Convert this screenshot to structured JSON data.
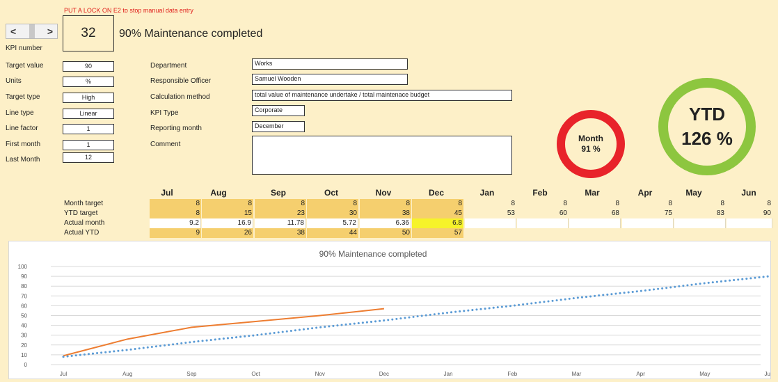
{
  "warning": "PUT A LOCK ON E2 to stop manual data entry",
  "spinner": {
    "left": "<",
    "right": ">"
  },
  "kpi": {
    "number": "32",
    "title": "90% Maintenance completed",
    "number_label": "KPI number"
  },
  "settings": [
    {
      "label": "Target value",
      "value": "90"
    },
    {
      "label": "Units",
      "value": "%"
    },
    {
      "label": "Target type",
      "value": "High"
    },
    {
      "label": "Line type",
      "value": "Linear"
    },
    {
      "label": "Line factor",
      "value": "1"
    },
    {
      "label": "First month",
      "value": "1"
    },
    {
      "label": "Last Month",
      "value": "12"
    }
  ],
  "details": [
    {
      "label": "Department",
      "value": "Works"
    },
    {
      "label": "Responsible Officer",
      "value": "Samuel Wooden"
    },
    {
      "label": "Calculation method",
      "value": "total value of maintenance undertake / total maintenace budget"
    },
    {
      "label": "KPI Type",
      "value": "Corporate"
    },
    {
      "label": "Reporting month",
      "value": "December"
    },
    {
      "label": "Comment",
      "value": ""
    }
  ],
  "month_gauge": {
    "label": "Month",
    "value": "91 %",
    "color": "#e8232a"
  },
  "ytd_gauge": {
    "label": "YTD",
    "value": "126 %",
    "color": "#8dc63f"
  },
  "table": {
    "months": [
      "Jul",
      "Aug",
      "Sep",
      "Oct",
      "Nov",
      "Dec",
      "Jan",
      "Feb",
      "Mar",
      "Apr",
      "May",
      "Jun"
    ],
    "rows": [
      {
        "label": "Month target",
        "values": [
          "8",
          "8",
          "8",
          "8",
          "8",
          "8",
          "8",
          "8",
          "8",
          "8",
          "8",
          "8"
        ]
      },
      {
        "label": "YTD target",
        "values": [
          "8",
          "15",
          "23",
          "30",
          "38",
          "45",
          "53",
          "60",
          "68",
          "75",
          "83",
          "90"
        ]
      },
      {
        "label": "Actual month",
        "values": [
          "9.2",
          "16.9",
          "11.78",
          "5.72",
          "6.36",
          "6.8",
          "",
          "",
          "",
          "",
          "",
          ""
        ]
      },
      {
        "label": "Actual YTD",
        "values": [
          "9",
          "26",
          "38",
          "44",
          "50",
          "57",
          "",
          "",
          "",
          "",
          "",
          ""
        ]
      }
    ]
  },
  "chart_data": {
    "type": "line",
    "title": "90% Maintenance completed",
    "categories": [
      "Jul",
      "Aug",
      "Sep",
      "Oct",
      "Nov",
      "Dec",
      "Jan",
      "Feb",
      "Mar",
      "Apr",
      "May",
      "Jun"
    ],
    "ylim": [
      0,
      100
    ],
    "yticks": [
      0,
      10,
      20,
      30,
      40,
      50,
      60,
      70,
      80,
      90,
      100
    ],
    "grid": true,
    "series": [
      {
        "values": [
          9,
          26,
          38,
          44,
          50,
          57,
          null,
          null,
          null,
          null,
          null,
          null
        ],
        "color": "#ed7d31",
        "style": "solid"
      },
      {
        "values": [
          8,
          15,
          23,
          30,
          38,
          45,
          53,
          60,
          68,
          75,
          83,
          90
        ],
        "color": "#5b9bd5",
        "style": "dotted"
      }
    ]
  }
}
